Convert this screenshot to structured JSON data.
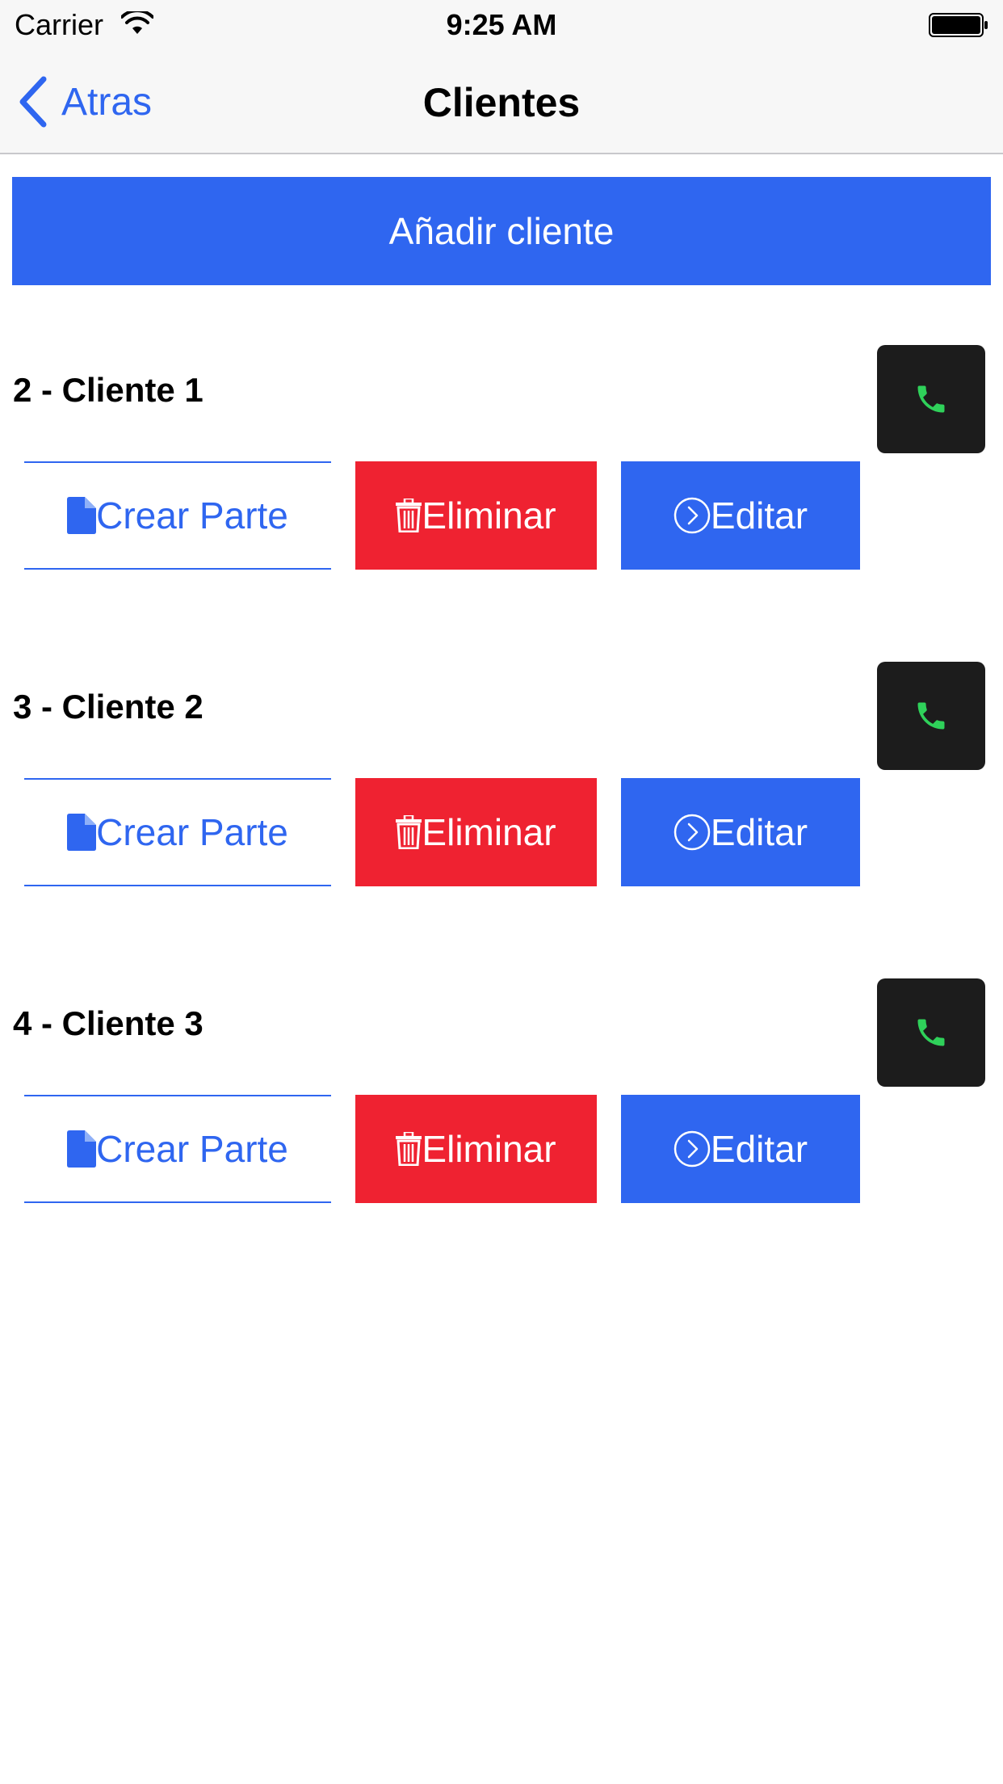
{
  "status_bar": {
    "carrier": "Carrier",
    "time": "9:25 AM"
  },
  "nav": {
    "back_label": "Atras",
    "title": "Clientes"
  },
  "add_button": {
    "label": "Añadir cliente"
  },
  "colors": {
    "accent": "#2f66f0",
    "danger": "#ef2231",
    "call_bg": "#1c1c1c",
    "call_icon": "#2fd15a"
  },
  "icons": {
    "back": "chevron-left-icon",
    "call": "phone-icon",
    "crear": "document-icon",
    "eliminar": "trash-icon",
    "editar": "chevron-circle-right-icon"
  },
  "clients": [
    {
      "name": "2 - Cliente 1",
      "crear_label": "Crear Parte",
      "eliminar_label": "Eliminar",
      "editar_label": "Editar"
    },
    {
      "name": "3 - Cliente 2",
      "crear_label": "Crear Parte",
      "eliminar_label": "Eliminar",
      "editar_label": "Editar"
    },
    {
      "name": "4 - Cliente 3",
      "crear_label": "Crear Parte",
      "eliminar_label": "Eliminar",
      "editar_label": "Editar"
    }
  ]
}
